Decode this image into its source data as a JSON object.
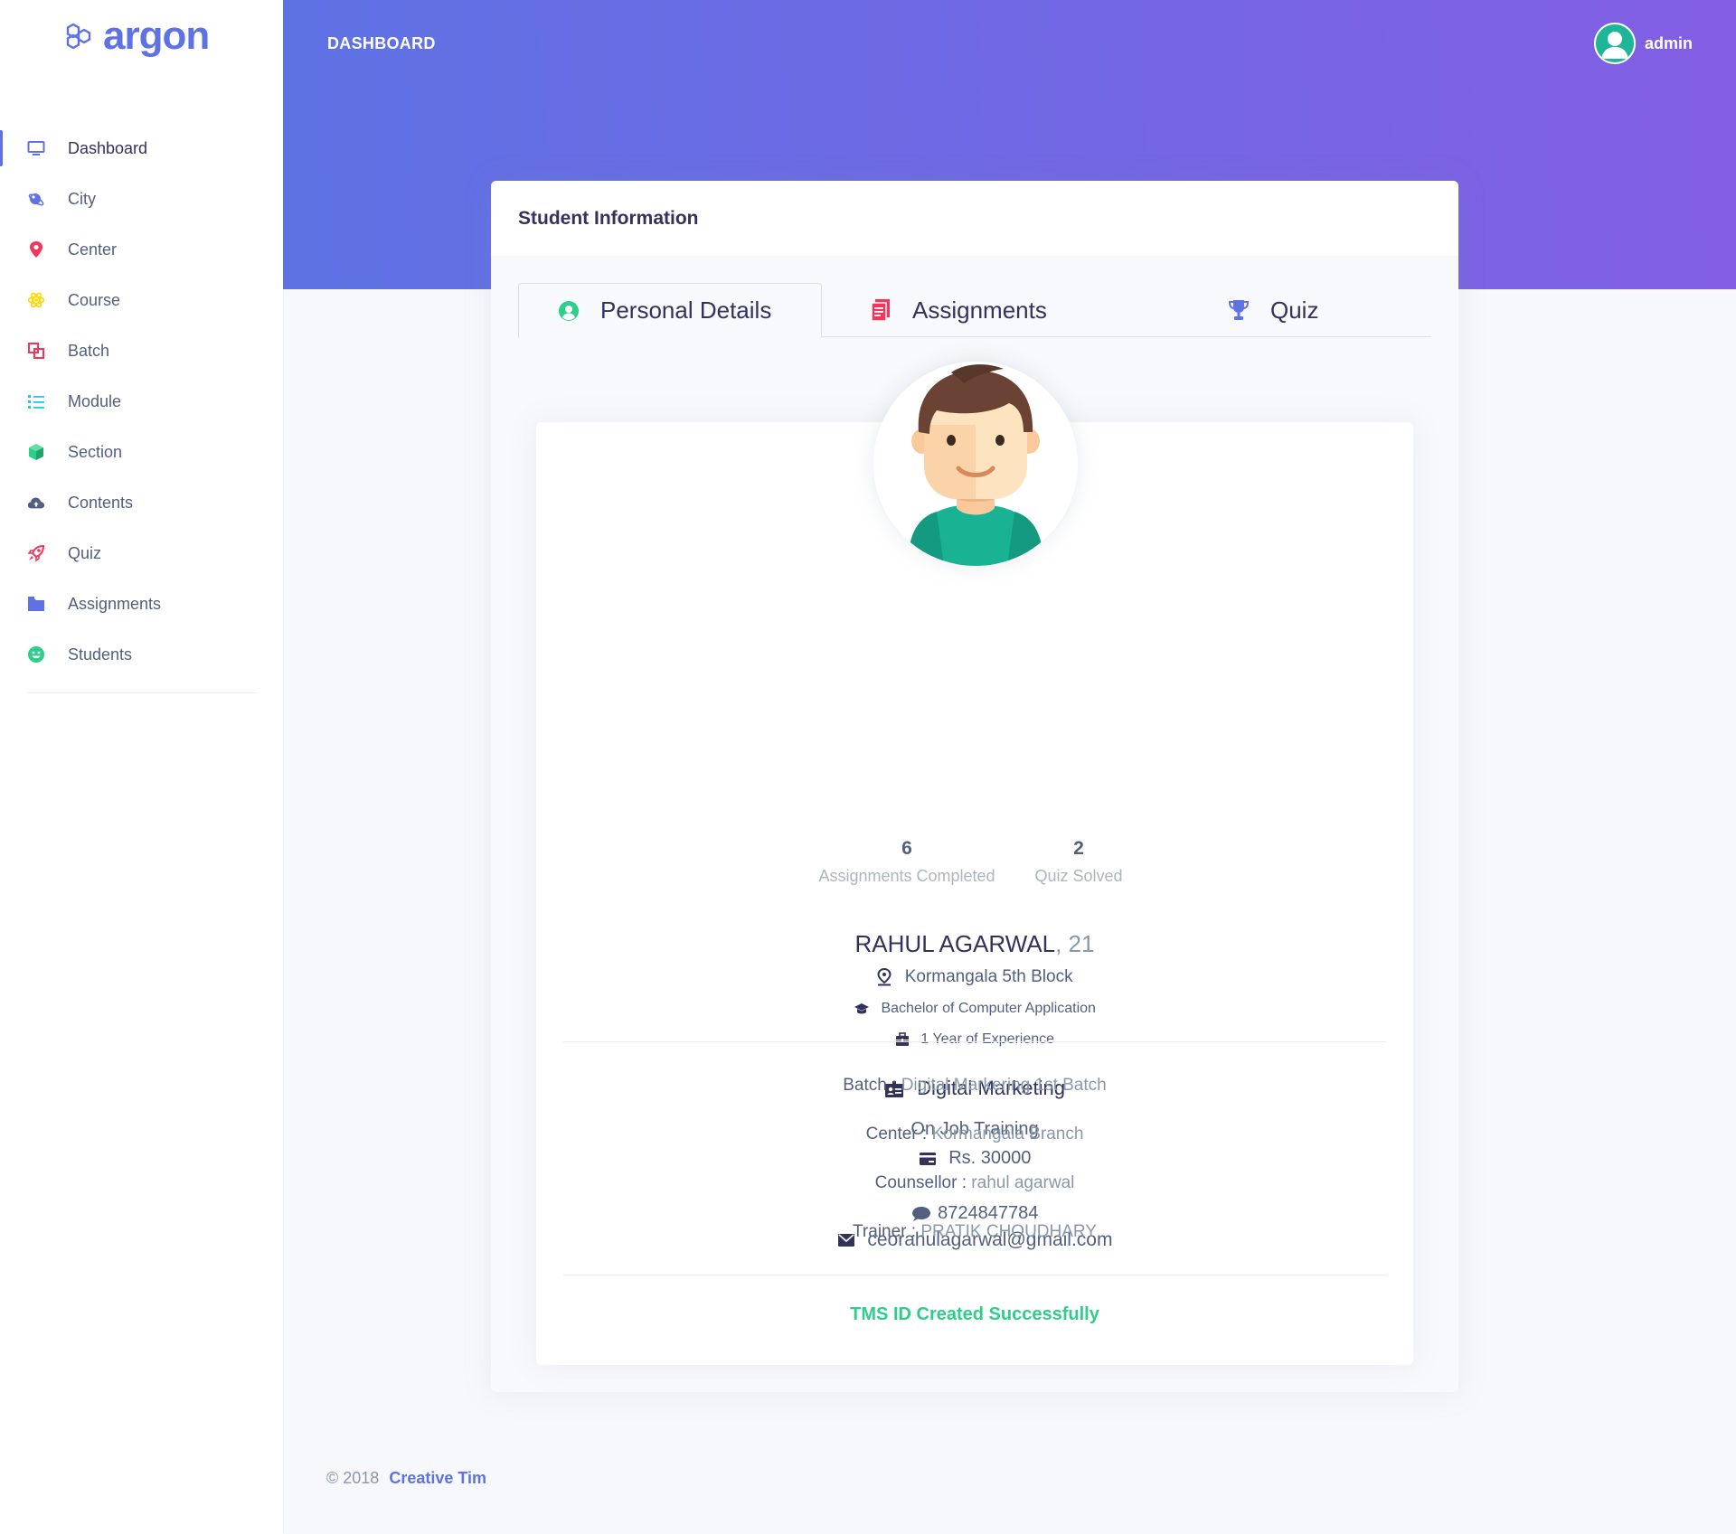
{
  "brand": {
    "name": "argon",
    "color": "#5e72e4"
  },
  "sidebar": {
    "items": [
      {
        "label": "Dashboard",
        "icon": "tv-icon",
        "color": "#5e72e4"
      },
      {
        "label": "City",
        "icon": "planet-icon",
        "color": "#5e72e4"
      },
      {
        "label": "Center",
        "icon": "pin-icon",
        "color": "#f5365c"
      },
      {
        "label": "Course",
        "icon": "atom-icon",
        "color": "#ffd600"
      },
      {
        "label": "Batch",
        "icon": "ungroup-icon",
        "color": "#f5365c"
      },
      {
        "label": "Module",
        "icon": "list-icon",
        "color": "#11cdef"
      },
      {
        "label": "Section",
        "icon": "box-icon",
        "color": "#2dce89"
      },
      {
        "label": "Contents",
        "icon": "cloud-upload-icon",
        "color": "#525f7f"
      },
      {
        "label": "Quiz",
        "icon": "rocket-icon",
        "color": "#f5365c"
      },
      {
        "label": "Assignments",
        "icon": "folder-icon",
        "color": "#5e72e4"
      },
      {
        "label": "Students",
        "icon": "smile-icon",
        "color": "#2dce89"
      }
    ]
  },
  "header": {
    "title": "DASHBOARD",
    "user": "admin"
  },
  "card": {
    "title": "Student Information",
    "tabs": [
      {
        "label": "Personal Details",
        "icon": "user-circle-icon",
        "color": "#2dce89"
      },
      {
        "label": "Assignments",
        "icon": "file-icon",
        "color": "#f5365c"
      },
      {
        "label": "Quiz",
        "icon": "trophy-icon",
        "color": "#5e72e4"
      }
    ]
  },
  "profile": {
    "stats": [
      {
        "value": "6",
        "label": "Assignments Completed"
      },
      {
        "value": "2",
        "label": "Quiz Solved"
      }
    ],
    "name": "RAHUL AGARWAL",
    "age": ", 21",
    "location": "Kormangala 5th Block",
    "degree": "Bachelor of Computer Application",
    "experience": "1 Year of Experience",
    "course": "Digital Marketing",
    "program": "On Job Training",
    "fee": "Rs. 30000",
    "phone": "8724847784",
    "email": "ceorahulagarwal@gmail.com",
    "details": [
      {
        "key": "Batch :",
        "value": "Digital Markering 1st Batch"
      },
      {
        "key": "Center :",
        "value": "Kormangala Branch"
      },
      {
        "key": "Counsellor :",
        "value": "rahul agarwal"
      },
      {
        "key": "Trainer :",
        "value": "PRATIK CHOUDHARY"
      }
    ],
    "status": "TMS ID Created Successfully"
  },
  "footer": {
    "copyright": "© 2018",
    "link": "Creative Tim"
  }
}
